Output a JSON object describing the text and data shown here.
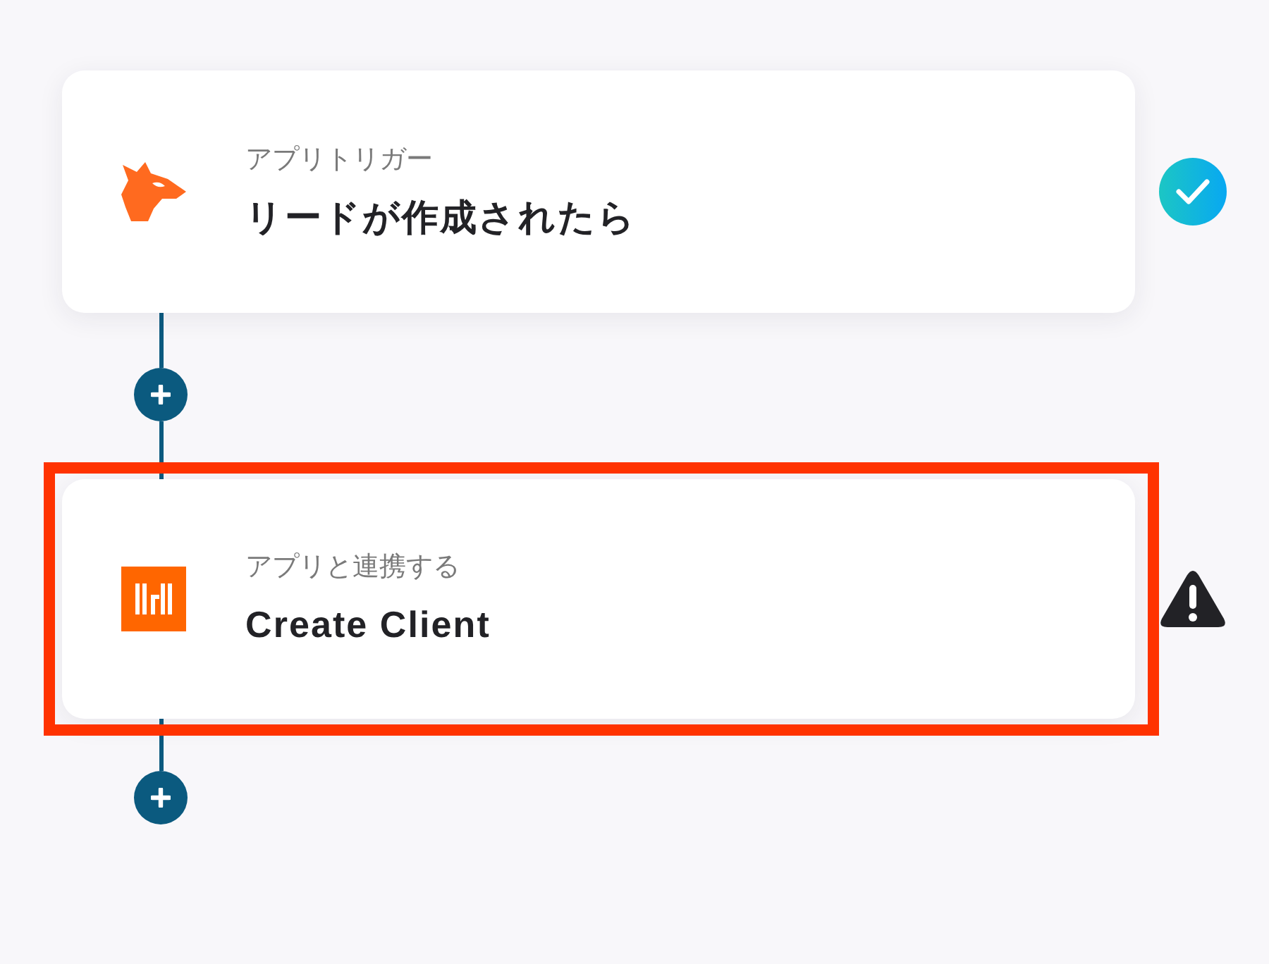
{
  "steps": [
    {
      "kind": "trigger",
      "category": "アプリトリガー",
      "title": "リードが作成されたら",
      "complete": true,
      "highlighted": false
    },
    {
      "kind": "action",
      "category": "アプリと連携する",
      "title": "Create Client",
      "complete": false,
      "highlighted": true
    }
  ]
}
